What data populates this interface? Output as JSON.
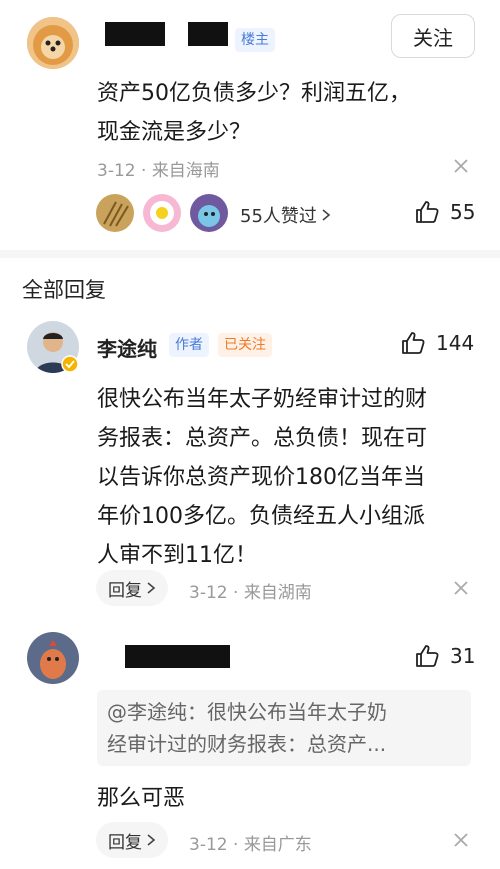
{
  "post": {
    "badge": "楼主",
    "follow_label": "关注",
    "text_line1": "资产50亿负债多少？利润五亿，",
    "text_line2": "现金流是多少？",
    "date": "3-12",
    "sep": "·",
    "location": "来自海南",
    "likers_summary": "55人赞过",
    "like_count": "55"
  },
  "section": {
    "title": "全部回复"
  },
  "reply1": {
    "username": "李途纯",
    "author_badge": "作者",
    "followed_badge": "已关注",
    "like_count": "144",
    "lines": [
      "很快公布当年太子奶经审计过的财",
      "务报表：总资产。总负债！现在可",
      "以告诉你总资产现价180亿当年当",
      "年价100多亿。负债经五人小组派",
      "人审不到11亿！"
    ],
    "reply_label": "回复",
    "date": "3-12",
    "sep": "·",
    "location": "来自湖南"
  },
  "reply2": {
    "like_count": "31",
    "quote_line1": "@李途纯：很快公布当年太子奶",
    "quote_line2": "经审计过的财务报表：总资产...",
    "text": "那么可恶",
    "reply_label": "回复",
    "date": "3-12",
    "sep": "·",
    "location": "来自广东"
  },
  "icons": {
    "like": "thumbs-up-icon",
    "close": "close-icon",
    "chevron": "chevron-right-icon",
    "verified": "verified-badge-icon"
  },
  "colors": {
    "blue_badge": "#4a7bd6",
    "orange_badge": "#f07a2a",
    "meta_gray": "#999999"
  }
}
